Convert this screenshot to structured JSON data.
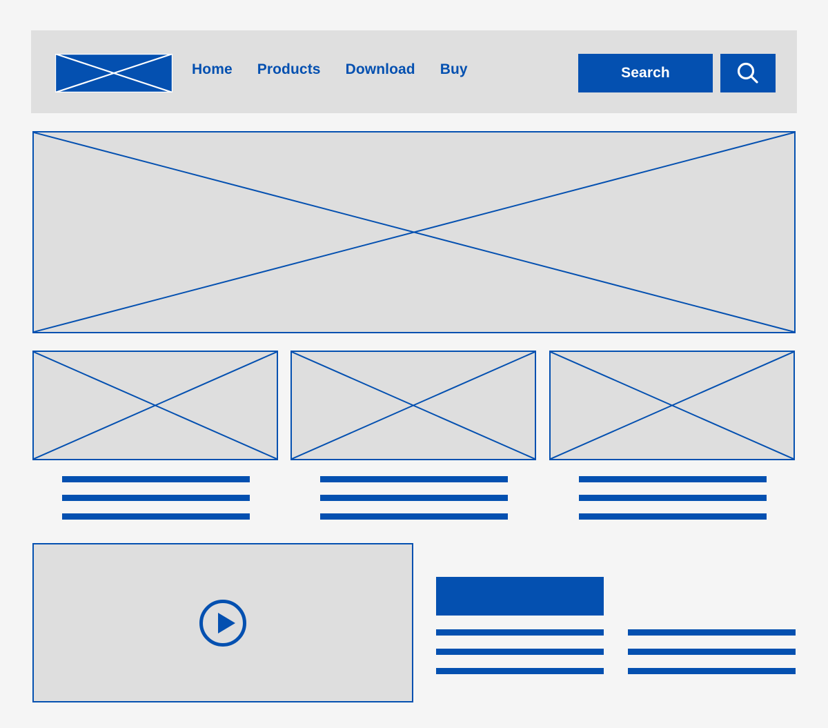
{
  "page": {
    "background_color": "#f5f5f5",
    "accent_color": "#0450b0",
    "placeholder_fill": "#dedede",
    "header_background": "#dfdfdf",
    "title": "Website Wireframe"
  },
  "header": {
    "logo": {
      "label": "Logo",
      "icon": "crossed-box-placeholder-icon"
    },
    "nav": {
      "items": [
        {
          "label": "Home"
        },
        {
          "label": "Products"
        },
        {
          "label": "Download"
        },
        {
          "label": "Buy"
        }
      ]
    },
    "search": {
      "value": "Search",
      "placeholder": "Search",
      "button_icon": "magnifier-icon"
    }
  },
  "hero": {
    "label": "Hero image placeholder",
    "icon": "crossed-box-placeholder-icon"
  },
  "cards": [
    {
      "image_label": "Image placeholder",
      "icon": "crossed-box-placeholder-icon",
      "lines": [
        "",
        "",
        ""
      ]
    },
    {
      "image_label": "Image placeholder",
      "icon": "crossed-box-placeholder-icon",
      "lines": [
        "",
        "",
        ""
      ]
    },
    {
      "image_label": "Image placeholder",
      "icon": "crossed-box-placeholder-icon",
      "lines": [
        "",
        "",
        ""
      ]
    }
  ],
  "media": {
    "video": {
      "label": "Video placeholder",
      "play_icon": "play-circle-icon"
    },
    "heading_block": {
      "label": "Heading placeholder"
    },
    "columns": [
      {
        "lines": [
          "",
          "",
          ""
        ]
      },
      {
        "lines": [
          "",
          "",
          ""
        ]
      }
    ]
  }
}
